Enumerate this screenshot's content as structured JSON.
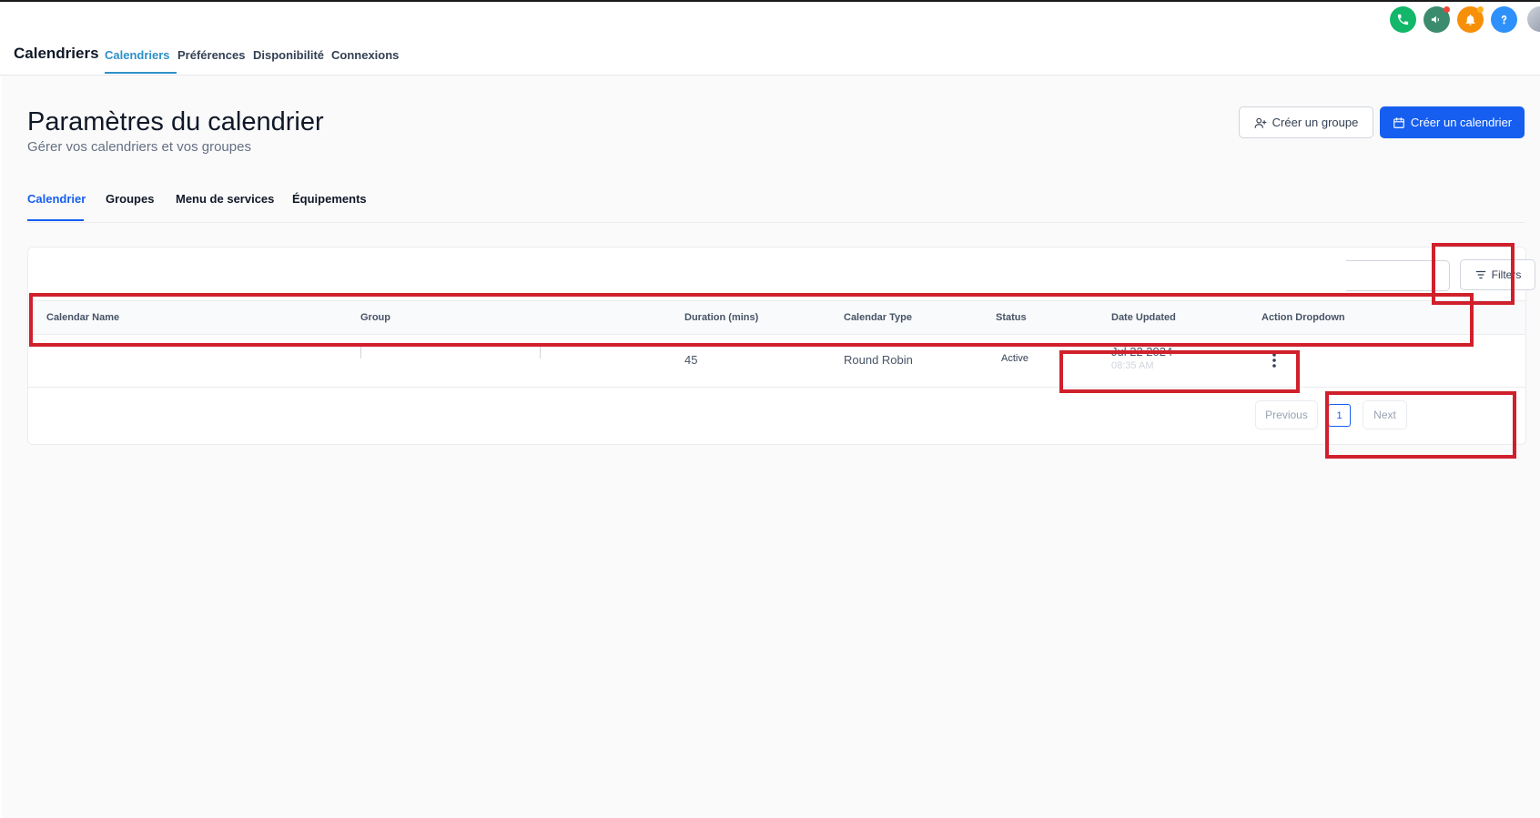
{
  "app": {
    "title": "Calendriers",
    "nav_tabs": [
      {
        "label": "Calendriers",
        "active": true
      },
      {
        "label": "Préférences",
        "active": false
      },
      {
        "label": "Disponibilité",
        "active": false
      },
      {
        "label": "Connexions",
        "active": false
      }
    ],
    "header_icons": [
      {
        "name": "phone-icon",
        "color": "#12b76a"
      },
      {
        "name": "megaphone-icon",
        "color": "#3b8c6e"
      },
      {
        "name": "bell-icon",
        "color": "#f79009"
      },
      {
        "name": "help-icon",
        "color": "#2e90fa"
      }
    ]
  },
  "page": {
    "title": "Paramètres du calendrier",
    "subtitle": "Gérer vos calendriers et vos groupes",
    "create_group_label": "Créer un groupe",
    "create_calendar_label": "Créer un calendrier",
    "primary_color": "#155eef"
  },
  "sub_tabs": [
    {
      "label": "Calendrier",
      "active": true
    },
    {
      "label": "Groupes",
      "active": false
    },
    {
      "label": "Menu de services",
      "active": false
    },
    {
      "label": "Équipements",
      "active": false
    }
  ],
  "table": {
    "filters_label": "Filters",
    "columns": [
      "Calendar Name",
      "Group",
      "Duration (mins)",
      "Calendar Type",
      "Status",
      "Date Updated",
      "Action Dropdown"
    ],
    "rows": [
      {
        "calendar_name": "",
        "group": "",
        "duration": "45",
        "calendar_type": "Round Robin",
        "status": "Active",
        "date_updated": "Jul 22 2024",
        "time_updated": "08:35 AM"
      }
    ],
    "pagination": {
      "previous_label": "Previous",
      "current_page": "1",
      "next_label": "Next"
    }
  },
  "annotation_color": "#d0202b"
}
